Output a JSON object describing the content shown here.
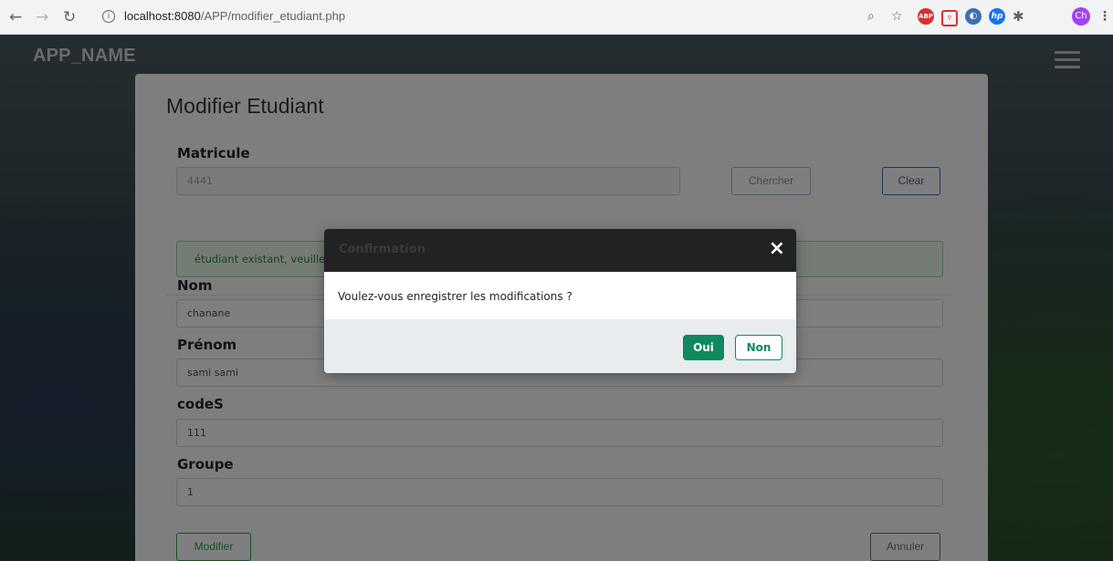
{
  "browser": {
    "url_host": "localhost:8080",
    "url_path": "/APP/modifier_etudiant.php",
    "extensions": {
      "abp": "ABP",
      "hp": "hp",
      "avatar": "Ch"
    }
  },
  "navbar": {
    "brand": "APP_NAME"
  },
  "form": {
    "title": "Modifier Etudiant",
    "matricule": {
      "label": "Matricule",
      "value": "4441"
    },
    "search_button": "Chercher",
    "clear_button": "Clear",
    "alert": "étudiant existant, veuillez modifier les données",
    "nom": {
      "label": "Nom",
      "value": "chanane"
    },
    "prenom": {
      "label": "Prénom",
      "value": "sami sami"
    },
    "codes": {
      "label": "codeS",
      "value": "111"
    },
    "groupe": {
      "label": "Groupe",
      "value": "1"
    },
    "submit_button": "Modifier",
    "cancel_button": "Annuler"
  },
  "modal": {
    "title": "Confirmation",
    "close": "×",
    "message": "Voulez-vous enregistrer les modifications ?",
    "yes": "Oui",
    "no": "Non"
  },
  "colors": {
    "confirm_green": "#0f8a5f",
    "alert_green": "#2e8b3e"
  }
}
